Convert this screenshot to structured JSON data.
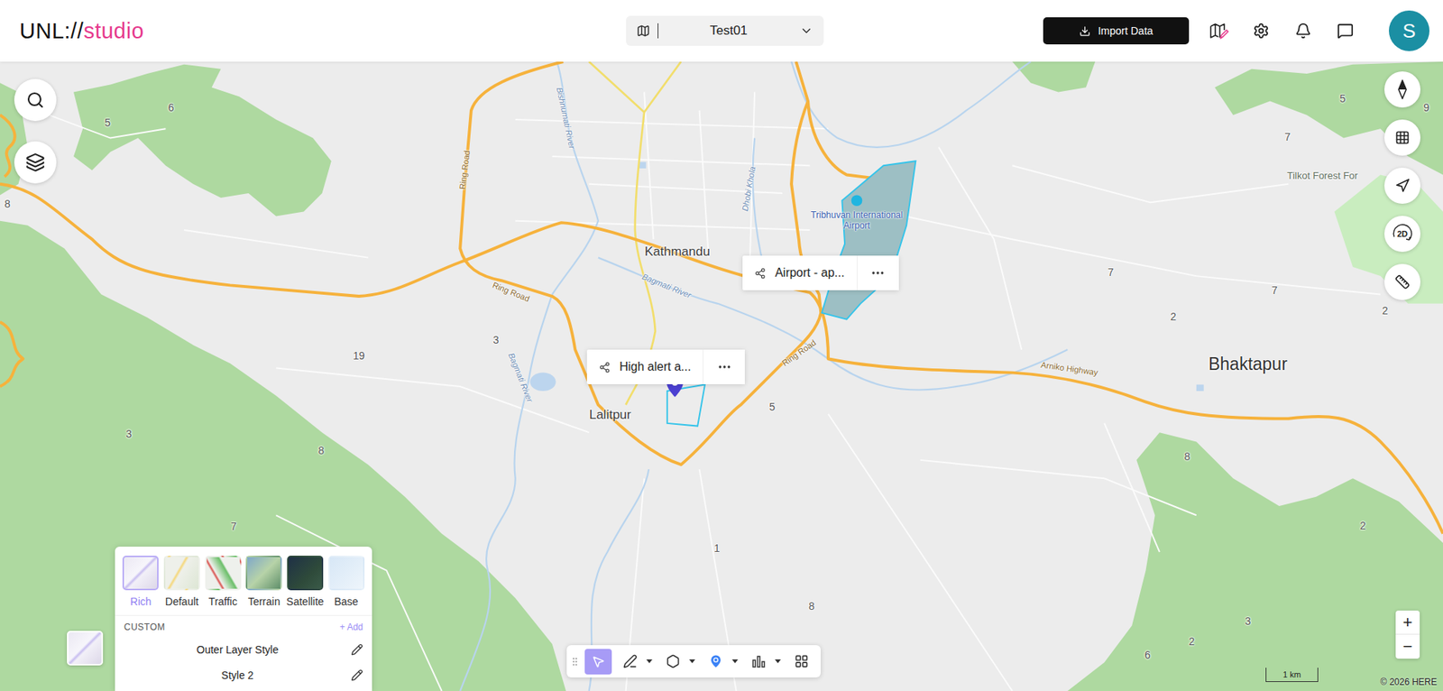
{
  "header": {
    "logo": {
      "main": "UNL://",
      "accent": "studio"
    },
    "project": {
      "name": "Test01"
    },
    "import_button": {
      "label": "Import Data"
    },
    "avatar": {
      "initial": "S"
    }
  },
  "map_controls": {
    "view_mode": "2D"
  },
  "map": {
    "labels": [
      {
        "text": "Kathmandu",
        "kind": "city"
      },
      {
        "text": "Lalitpur",
        "kind": "city"
      },
      {
        "text": "Bhaktapur",
        "kind": "bigcity"
      },
      {
        "text": "Tribhuvan International Airport",
        "kind": "poi"
      },
      {
        "text": "Ring Road",
        "kind": "road"
      },
      {
        "text": "Ring Road",
        "kind": "road"
      },
      {
        "text": "Ring Road",
        "kind": "road"
      },
      {
        "text": "Bagmati River",
        "kind": "river"
      },
      {
        "text": "Bishnumati River",
        "kind": "river"
      },
      {
        "text": "Dhobi Khola",
        "kind": "river"
      },
      {
        "text": "Bagmati River",
        "kind": "river"
      },
      {
        "text": "Arniko Highway",
        "kind": "road"
      },
      {
        "text": "Tilkot Forest For",
        "kind": "forest"
      },
      {
        "text": "5",
        "kind": "number"
      },
      {
        "text": "6",
        "kind": "number"
      },
      {
        "text": "8",
        "kind": "number"
      },
      {
        "text": "3",
        "kind": "number"
      },
      {
        "text": "19",
        "kind": "number"
      },
      {
        "text": "3",
        "kind": "number"
      },
      {
        "text": "8",
        "kind": "number"
      },
      {
        "text": "7",
        "kind": "number"
      },
      {
        "text": "5",
        "kind": "number"
      },
      {
        "text": "1",
        "kind": "number"
      },
      {
        "text": "8",
        "kind": "number"
      },
      {
        "text": "7",
        "kind": "number"
      },
      {
        "text": "7",
        "kind": "number"
      },
      {
        "text": "2",
        "kind": "number"
      },
      {
        "text": "7",
        "kind": "number"
      },
      {
        "text": "5",
        "kind": "number"
      },
      {
        "text": "9",
        "kind": "number"
      },
      {
        "text": "2",
        "kind": "number"
      },
      {
        "text": "8",
        "kind": "number"
      },
      {
        "text": "2",
        "kind": "number"
      },
      {
        "text": "3",
        "kind": "number"
      },
      {
        "text": "2",
        "kind": "number"
      },
      {
        "text": "6",
        "kind": "number"
      }
    ],
    "popups": [
      {
        "label": "Airport - ap..."
      },
      {
        "label": "High alert a..."
      }
    ]
  },
  "toolbar": {
    "tools": [
      {
        "kind": "handle",
        "selected": false,
        "has_menu": false
      },
      {
        "kind": "select",
        "selected": true,
        "has_menu": false
      },
      {
        "kind": "draw",
        "selected": false,
        "has_menu": true
      },
      {
        "kind": "polygon",
        "selected": false,
        "has_menu": true
      },
      {
        "kind": "pin",
        "selected": false,
        "has_menu": true
      },
      {
        "kind": "chart",
        "selected": false,
        "has_menu": true
      },
      {
        "kind": "widgets",
        "selected": false,
        "has_menu": false
      }
    ]
  },
  "base_styles": {
    "styles": [
      {
        "label": "Rich",
        "selected": true
      },
      {
        "label": "Default",
        "selected": false
      },
      {
        "label": "Traffic",
        "selected": false
      },
      {
        "label": "Terrain",
        "selected": false
      },
      {
        "label": "Satellite",
        "selected": false
      },
      {
        "label": "Base",
        "selected": false
      }
    ],
    "custom": {
      "title": "CUSTOM",
      "add": "+ Add",
      "items": [
        {
          "label": "Outer Layer Style"
        },
        {
          "label": "Style 2"
        }
      ]
    }
  },
  "zoom": {
    "in": "+",
    "out": "−"
  },
  "scale": {
    "label": "1 km"
  },
  "attribution": "© 2026 HERE"
}
